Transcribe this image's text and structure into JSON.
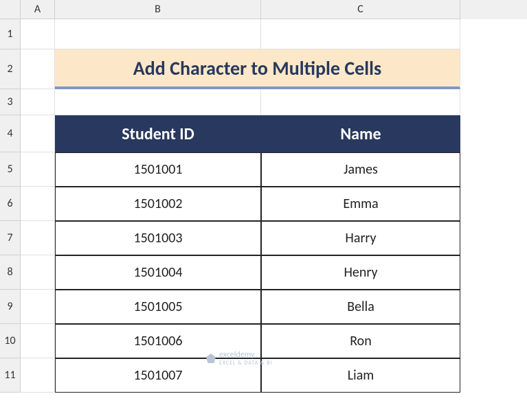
{
  "columns": [
    "A",
    "B",
    "C"
  ],
  "rows": [
    "1",
    "2",
    "3",
    "4",
    "5",
    "6",
    "7",
    "8",
    "9",
    "10",
    "11"
  ],
  "title": "Add Character to Multiple Cells",
  "headers": {
    "student_id": "Student ID",
    "name": "Name"
  },
  "chart_data": {
    "type": "table",
    "columns": [
      "Student ID",
      "Name"
    ],
    "rows": [
      {
        "id": "1501001",
        "name": "James"
      },
      {
        "id": "1501002",
        "name": "Emma"
      },
      {
        "id": "1501003",
        "name": "Harry"
      },
      {
        "id": "1501004",
        "name": "Henry"
      },
      {
        "id": "1501005",
        "name": "Bella"
      },
      {
        "id": "1501006",
        "name": "Ron"
      },
      {
        "id": "1501007",
        "name": "Liam"
      }
    ]
  },
  "watermark": {
    "brand": "exceldemy",
    "tagline": "EXCEL & DATA & BI"
  }
}
